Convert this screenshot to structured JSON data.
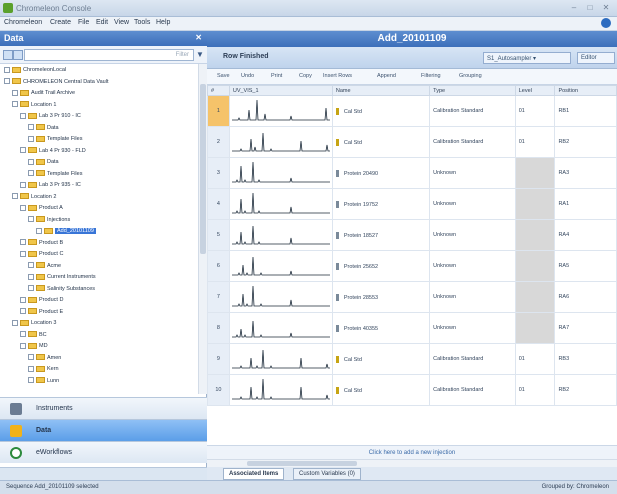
{
  "window": {
    "title": "Chromeleon Console"
  },
  "menu": {
    "items": [
      "Chromeleon",
      "Create",
      "File",
      "Edit",
      "View",
      "Tools",
      "Help"
    ]
  },
  "left_pane": {
    "title": "Data",
    "filter_placeholder": "Filter",
    "tree": [
      {
        "label": "ChromeleonLocal",
        "depth": 0
      },
      {
        "label": "CHROMELEON Central Data Vault",
        "depth": 0
      },
      {
        "label": "Audit Trail Archive",
        "depth": 1
      },
      {
        "label": "Location 1",
        "depth": 1
      },
      {
        "label": "Lab 3 Pr 910 - IC",
        "depth": 2
      },
      {
        "label": "Data",
        "depth": 3
      },
      {
        "label": "Template Files",
        "depth": 3
      },
      {
        "label": "Lab 4 Pr 930 - FLD",
        "depth": 2
      },
      {
        "label": "Data",
        "depth": 3
      },
      {
        "label": "Template Files",
        "depth": 3
      },
      {
        "label": "Lab 3 Pr 935 - IC",
        "depth": 2
      },
      {
        "label": "Location 2",
        "depth": 1
      },
      {
        "label": "Product A",
        "depth": 2
      },
      {
        "label": "Injections",
        "depth": 3
      },
      {
        "label": "Add_20101109",
        "depth": 4,
        "selected": true
      },
      {
        "label": "Product B",
        "depth": 2
      },
      {
        "label": "Product C",
        "depth": 2
      },
      {
        "label": "Acme",
        "depth": 3
      },
      {
        "label": "Current Instruments",
        "depth": 3
      },
      {
        "label": "Salinity Substances",
        "depth": 3
      },
      {
        "label": "Product D",
        "depth": 2
      },
      {
        "label": "Product E",
        "depth": 2
      },
      {
        "label": "Location 3",
        "depth": 1
      },
      {
        "label": "BC",
        "depth": 2
      },
      {
        "label": "MD",
        "depth": 2
      },
      {
        "label": "Amen",
        "depth": 3
      },
      {
        "label": "Kern",
        "depth": 3
      },
      {
        "label": "Lunn",
        "depth": 3
      }
    ],
    "nav": [
      {
        "label": "Instruments",
        "color": "#6b7c93"
      },
      {
        "label": "Data",
        "color": "#f0b21a",
        "active": true
      },
      {
        "label": "eWorkflows",
        "color": "#2c8a3c"
      }
    ]
  },
  "right_pane": {
    "title": "Add_20101109",
    "tab_label": "Row Finished",
    "combo_value": "S1_Autosampler",
    "header_button": "Editor",
    "toolbar": [
      "Save",
      "Undo",
      "Print",
      "Copy",
      "Insert Rows",
      "Append",
      "Filtering",
      "Grouping"
    ],
    "columns": [
      "#",
      "UV_VIS_1",
      "Name",
      "Type",
      "Level",
      "Position"
    ],
    "rows": [
      {
        "num": "1",
        "name": "Cal Std",
        "type": "Calibration Standard",
        "level": "01",
        "position": "RB1",
        "vial": "std"
      },
      {
        "num": "2",
        "name": "Cal Std",
        "type": "Calibration Standard",
        "level": "01",
        "position": "RB2",
        "vial": "std"
      },
      {
        "num": "3",
        "name": "Protein 20490",
        "type": "Unknown",
        "level": "",
        "position": "RA3",
        "vial": "unk"
      },
      {
        "num": "4",
        "name": "Protein 19752",
        "type": "Unknown",
        "level": "",
        "position": "RA1",
        "vial": "unk"
      },
      {
        "num": "5",
        "name": "Protein 18527",
        "type": "Unknown",
        "level": "",
        "position": "RA4",
        "vial": "unk"
      },
      {
        "num": "6",
        "name": "Protein 25652",
        "type": "Unknown",
        "level": "",
        "position": "RA5",
        "vial": "unk"
      },
      {
        "num": "7",
        "name": "Protein 28553",
        "type": "Unknown",
        "level": "",
        "position": "RA6",
        "vial": "unk"
      },
      {
        "num": "8",
        "name": "Protein 40355",
        "type": "Unknown",
        "level": "",
        "position": "RA7",
        "vial": "unk"
      },
      {
        "num": "9",
        "name": "Cal Std",
        "type": "Calibration Standard",
        "level": "01",
        "position": "RB3",
        "vial": "std"
      },
      {
        "num": "10",
        "name": "Cal Std",
        "type": "Calibration Standard",
        "level": "01",
        "position": "RB2",
        "vial": "std"
      }
    ],
    "add_row_text": "Click here to add a new injection",
    "bottom_tabs": [
      "Associated Items",
      "Custom Variables (0)"
    ]
  },
  "status": {
    "left": "Sequence Add_20101109 selected",
    "right": "Grouped by: Chromeleon"
  }
}
